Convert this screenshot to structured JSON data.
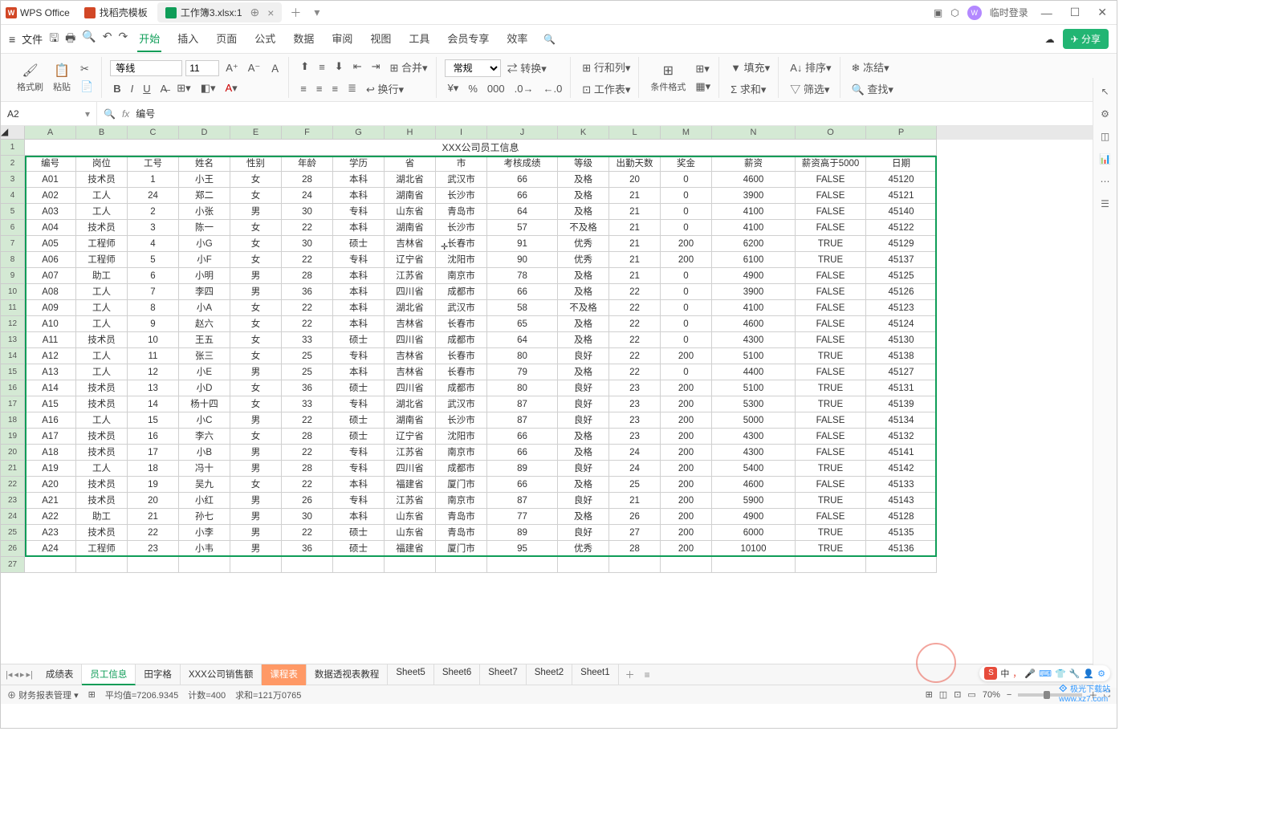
{
  "titlebar": {
    "app": "WPS Office",
    "template_tab": "找稻壳模板",
    "doc_tab": "工作簿3.xlsx:1",
    "login": "临时登录"
  },
  "menubar": {
    "file": "文件",
    "tabs": [
      "开始",
      "插入",
      "页面",
      "公式",
      "数据",
      "审阅",
      "视图",
      "工具",
      "会员专享",
      "效率"
    ],
    "share": "分享"
  },
  "toolbar": {
    "format_painter": "格式刷",
    "paste": "粘贴",
    "font": "等线",
    "size": "11",
    "merge": "合并",
    "wrap": "换行",
    "number_format": "常规",
    "convert": "转换",
    "row_col": "行和列",
    "worksheet": "工作表",
    "cond_format": "条件格式",
    "fill": "填充",
    "sum": "求和",
    "sort": "排序",
    "freeze": "冻结",
    "filter": "筛选",
    "find": "查找"
  },
  "namebox": {
    "cell": "A2",
    "formula": "编号"
  },
  "table": {
    "title": "XXX公司员工信息",
    "cols": [
      "A",
      "B",
      "C",
      "D",
      "E",
      "F",
      "G",
      "H",
      "I",
      "J",
      "K",
      "L",
      "M",
      "N",
      "O",
      "P"
    ],
    "headers": [
      "编号",
      "岗位",
      "工号",
      "姓名",
      "性别",
      "年龄",
      "学历",
      "省",
      "市",
      "考核成绩",
      "等级",
      "出勤天数",
      "奖金",
      "薪资",
      "薪资高于5000",
      "日期"
    ],
    "rows": [
      [
        "A01",
        "技术员",
        "1",
        "小王",
        "女",
        "28",
        "本科",
        "湖北省",
        "武汉市",
        "66",
        "及格",
        "20",
        "0",
        "4600",
        "FALSE",
        "45120"
      ],
      [
        "A02",
        "工人",
        "24",
        "郑二",
        "女",
        "24",
        "本科",
        "湖南省",
        "长沙市",
        "66",
        "及格",
        "21",
        "0",
        "3900",
        "FALSE",
        "45121"
      ],
      [
        "A03",
        "工人",
        "2",
        "小张",
        "男",
        "30",
        "专科",
        "山东省",
        "青岛市",
        "64",
        "及格",
        "21",
        "0",
        "4100",
        "FALSE",
        "45140"
      ],
      [
        "A04",
        "技术员",
        "3",
        "陈一",
        "女",
        "22",
        "本科",
        "湖南省",
        "长沙市",
        "57",
        "不及格",
        "21",
        "0",
        "4100",
        "FALSE",
        "45122"
      ],
      [
        "A05",
        "工程师",
        "4",
        "小G",
        "女",
        "30",
        "硕士",
        "吉林省",
        "长春市",
        "91",
        "优秀",
        "21",
        "200",
        "6200",
        "TRUE",
        "45129"
      ],
      [
        "A06",
        "工程师",
        "5",
        "小F",
        "女",
        "22",
        "专科",
        "辽宁省",
        "沈阳市",
        "90",
        "优秀",
        "21",
        "200",
        "6100",
        "TRUE",
        "45137"
      ],
      [
        "A07",
        "助工",
        "6",
        "小明",
        "男",
        "28",
        "本科",
        "江苏省",
        "南京市",
        "78",
        "及格",
        "21",
        "0",
        "4900",
        "FALSE",
        "45125"
      ],
      [
        "A08",
        "工人",
        "7",
        "李四",
        "男",
        "36",
        "本科",
        "四川省",
        "成都市",
        "66",
        "及格",
        "22",
        "0",
        "3900",
        "FALSE",
        "45126"
      ],
      [
        "A09",
        "工人",
        "8",
        "小A",
        "女",
        "22",
        "本科",
        "湖北省",
        "武汉市",
        "58",
        "不及格",
        "22",
        "0",
        "4100",
        "FALSE",
        "45123"
      ],
      [
        "A10",
        "工人",
        "9",
        "赵六",
        "女",
        "22",
        "本科",
        "吉林省",
        "长春市",
        "65",
        "及格",
        "22",
        "0",
        "4600",
        "FALSE",
        "45124"
      ],
      [
        "A11",
        "技术员",
        "10",
        "王五",
        "女",
        "33",
        "硕士",
        "四川省",
        "成都市",
        "64",
        "及格",
        "22",
        "0",
        "4300",
        "FALSE",
        "45130"
      ],
      [
        "A12",
        "工人",
        "11",
        "张三",
        "女",
        "25",
        "专科",
        "吉林省",
        "长春市",
        "80",
        "良好",
        "22",
        "200",
        "5100",
        "TRUE",
        "45138"
      ],
      [
        "A13",
        "工人",
        "12",
        "小E",
        "男",
        "25",
        "本科",
        "吉林省",
        "长春市",
        "79",
        "及格",
        "22",
        "0",
        "4400",
        "FALSE",
        "45127"
      ],
      [
        "A14",
        "技术员",
        "13",
        "小D",
        "女",
        "36",
        "硕士",
        "四川省",
        "成都市",
        "80",
        "良好",
        "23",
        "200",
        "5100",
        "TRUE",
        "45131"
      ],
      [
        "A15",
        "技术员",
        "14",
        "杨十四",
        "女",
        "33",
        "专科",
        "湖北省",
        "武汉市",
        "87",
        "良好",
        "23",
        "200",
        "5300",
        "TRUE",
        "45139"
      ],
      [
        "A16",
        "工人",
        "15",
        "小C",
        "男",
        "22",
        "硕士",
        "湖南省",
        "长沙市",
        "87",
        "良好",
        "23",
        "200",
        "5000",
        "FALSE",
        "45134"
      ],
      [
        "A17",
        "技术员",
        "16",
        "李六",
        "女",
        "28",
        "硕士",
        "辽宁省",
        "沈阳市",
        "66",
        "及格",
        "23",
        "200",
        "4300",
        "FALSE",
        "45132"
      ],
      [
        "A18",
        "技术员",
        "17",
        "小B",
        "男",
        "22",
        "专科",
        "江苏省",
        "南京市",
        "66",
        "及格",
        "24",
        "200",
        "4300",
        "FALSE",
        "45141"
      ],
      [
        "A19",
        "工人",
        "18",
        "冯十",
        "男",
        "28",
        "专科",
        "四川省",
        "成都市",
        "89",
        "良好",
        "24",
        "200",
        "5400",
        "TRUE",
        "45142"
      ],
      [
        "A20",
        "技术员",
        "19",
        "吴九",
        "女",
        "22",
        "本科",
        "福建省",
        "厦门市",
        "66",
        "及格",
        "25",
        "200",
        "4600",
        "FALSE",
        "45133"
      ],
      [
        "A21",
        "技术员",
        "20",
        "小红",
        "男",
        "26",
        "专科",
        "江苏省",
        "南京市",
        "87",
        "良好",
        "21",
        "200",
        "5900",
        "TRUE",
        "45143"
      ],
      [
        "A22",
        "助工",
        "21",
        "孙七",
        "男",
        "30",
        "本科",
        "山东省",
        "青岛市",
        "77",
        "及格",
        "26",
        "200",
        "4900",
        "FALSE",
        "45128"
      ],
      [
        "A23",
        "技术员",
        "22",
        "小李",
        "男",
        "22",
        "硕士",
        "山东省",
        "青岛市",
        "89",
        "良好",
        "27",
        "200",
        "6000",
        "TRUE",
        "45135"
      ],
      [
        "A24",
        "工程师",
        "23",
        "小韦",
        "男",
        "36",
        "硕士",
        "福建省",
        "厦门市",
        "95",
        "优秀",
        "28",
        "200",
        "10100",
        "TRUE",
        "45136"
      ]
    ]
  },
  "sheet_tabs": [
    "成绩表",
    "员工信息",
    "田字格",
    "XXX公司销售额",
    "课程表",
    "数据透视表教程",
    "Sheet5",
    "Sheet6",
    "Sheet7",
    "Sheet2",
    "Sheet1"
  ],
  "sheet_active": 1,
  "sheet_orange": 4,
  "statusbar": {
    "mode": "财务报表管理",
    "avg": "平均值=7206.9345",
    "count": "计数=400",
    "sum": "求和=121万0765",
    "zoom": "70%"
  },
  "download_site": "www.xz7.com",
  "download_label": "极光下载站",
  "ime_label": "中"
}
